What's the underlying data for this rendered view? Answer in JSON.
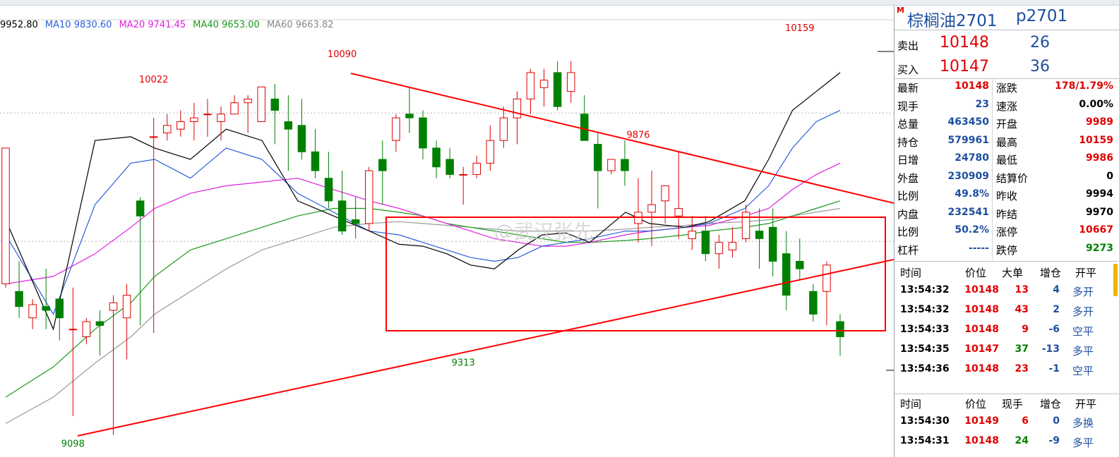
{
  "legend": {
    "close": "9952.80",
    "ma10": "MA10 9830.60",
    "ma20": "MA20 9741.45",
    "ma40": "MA40 9653.00",
    "ma60": "MA60 9663.82"
  },
  "colors": {
    "up": "#e00000",
    "down": "#008000",
    "ma5": "#000000",
    "ma10": "#2b5fd9",
    "ma20": "#e020e0",
    "ma40": "#1a9a1a",
    "ma60": "#999999",
    "pattern": "#ff0000"
  },
  "chart_data": {
    "type": "candlestick",
    "ylim": [
      9060,
      10200
    ],
    "annotations": [
      {
        "text": "10090",
        "candle": 25,
        "price": 10090,
        "pos": "above"
      },
      {
        "text": "10022",
        "candle": 11,
        "price": 10022,
        "pos": "above"
      },
      {
        "text": "9876",
        "candle": 47,
        "price": 9876,
        "pos": "above"
      },
      {
        "text": "10159",
        "candle": 59,
        "price": 10159,
        "pos": "above"
      },
      {
        "text": "9313",
        "candle": 34,
        "price": 9313,
        "pos": "below"
      },
      {
        "text": "9098",
        "candle": 5,
        "price": 9098,
        "pos": "below"
      }
    ],
    "candles": [
      [
        9500,
        9860,
        9860,
        9490
      ],
      [
        9480,
        9440,
        9560,
        9410
      ],
      [
        9410,
        9445,
        9460,
        9380
      ],
      [
        9440,
        9430,
        9540,
        9380
      ],
      [
        9460,
        9410,
        9450,
        9350
      ],
      [
        9380,
        9380,
        9490,
        9150
      ],
      [
        9360,
        9400,
        9410,
        9340
      ],
      [
        9400,
        9390,
        9430,
        9310
      ],
      [
        9430,
        9450,
        9470,
        9100
      ],
      [
        9410,
        9470,
        9500,
        9300
      ],
      [
        9720,
        9680,
        9730,
        9390
      ],
      [
        9890,
        9890,
        9940,
        9370
      ],
      [
        9900,
        9920,
        9950,
        9880
      ],
      [
        9910,
        9930,
        9960,
        9890
      ],
      [
        9930,
        9940,
        9980,
        9880
      ],
      [
        9950,
        9950,
        9990,
        9890
      ],
      [
        9930,
        9950,
        9970,
        9880
      ],
      [
        9950,
        9980,
        10000,
        9950
      ],
      [
        9980,
        9990,
        10000,
        9900
      ],
      [
        9930,
        10022,
        10022,
        9930
      ],
      [
        9990,
        9960,
        10030,
        9870
      ],
      [
        9930,
        9910,
        10000,
        9800
      ],
      [
        9920,
        9850,
        9990,
        9830
      ],
      [
        9850,
        9800,
        9910,
        9780
      ],
      [
        9780,
        9720,
        9850,
        9700
      ],
      [
        9720,
        9640,
        9800,
        9630
      ],
      [
        9670,
        9660,
        9730,
        9620
      ],
      [
        9660,
        9800,
        9810,
        9640
      ],
      [
        9830,
        9800,
        9880,
        9710
      ],
      [
        9880,
        9940,
        9950,
        9850
      ],
      [
        9950,
        9940,
        10020,
        9900
      ],
      [
        9940,
        9860,
        9960,
        9830
      ],
      [
        9860,
        9810,
        9880,
        9780
      ],
      [
        9830,
        9790,
        9860,
        9780
      ],
      [
        9790,
        9790,
        9810,
        9710
      ],
      [
        9790,
        9820,
        9840,
        9780
      ],
      [
        9820,
        9880,
        9920,
        9800
      ],
      [
        9880,
        9940,
        9970,
        9860
      ],
      [
        9940,
        9990,
        10010,
        9870
      ],
      [
        9990,
        10060,
        10070,
        9950
      ],
      [
        10020,
        10040,
        10070,
        9970
      ],
      [
        10060,
        9970,
        10090,
        9960
      ],
      [
        10010,
        10060,
        10090,
        9980
      ],
      [
        9950,
        9880,
        10000,
        9900
      ],
      [
        9870,
        9800,
        9900,
        9700
      ],
      [
        9800,
        9830,
        9830,
        9790
      ],
      [
        9830,
        9800,
        9880,
        9760
      ],
      [
        9660,
        9690,
        9780,
        9610
      ],
      [
        9690,
        9710,
        9800,
        9600
      ],
      [
        9720,
        9760,
        9750,
        9660
      ],
      [
        9680,
        9700,
        9850,
        9620
      ],
      [
        9620,
        9640,
        9680,
        9590
      ],
      [
        9640,
        9580,
        9680,
        9560
      ],
      [
        9580,
        9610,
        9630,
        9540
      ],
      [
        9590,
        9610,
        9650,
        9570
      ],
      [
        9620,
        9690,
        9710,
        9610
      ],
      [
        9640,
        9620,
        9700,
        9540
      ],
      [
        9650,
        9560,
        9700,
        9520
      ],
      [
        9580,
        9470,
        9640,
        9430
      ],
      [
        9560,
        9540,
        9620,
        9510
      ],
      [
        9480,
        9420,
        9500,
        9400
      ],
      [
        9480,
        9550,
        9560,
        9390
      ],
      [
        9400,
        9360,
        9420,
        9310
      ]
    ],
    "ma5": [
      [
        0,
        9670
      ],
      [
        8,
        9380
      ],
      [
        15,
        9880
      ],
      [
        21,
        9890
      ],
      [
        25,
        9860
      ],
      [
        31,
        9830
      ],
      [
        37,
        9910
      ],
      [
        43,
        9880
      ],
      [
        49,
        9720
      ],
      [
        55,
        9680
      ],
      [
        61,
        9640
      ],
      [
        66,
        9605
      ],
      [
        70,
        9600
      ],
      [
        74,
        9580
      ],
      [
        78,
        9550
      ],
      [
        82,
        9540
      ],
      [
        86,
        9590
      ],
      [
        90,
        9630
      ],
      [
        94,
        9635
      ],
      [
        98,
        9610
      ],
      [
        104,
        9690
      ],
      [
        108,
        9660
      ],
      [
        114,
        9650
      ],
      [
        118,
        9665
      ],
      [
        124,
        9720
      ],
      [
        128,
        9830
      ],
      [
        132,
        9960
      ],
      [
        136,
        10010
      ],
      [
        140,
        10060
      ]
    ],
    "ma10": [
      [
        0,
        9630
      ],
      [
        8,
        9420
      ],
      [
        15,
        9710
      ],
      [
        21,
        9820
      ],
      [
        25,
        9830
      ],
      [
        31,
        9780
      ],
      [
        37,
        9860
      ],
      [
        43,
        9830
      ],
      [
        49,
        9740
      ],
      [
        55,
        9690
      ],
      [
        61,
        9640
      ],
      [
        66,
        9630
      ],
      [
        70,
        9610
      ],
      [
        74,
        9590
      ],
      [
        78,
        9570
      ],
      [
        82,
        9560
      ],
      [
        86,
        9570
      ],
      [
        90,
        9600
      ],
      [
        94,
        9610
      ],
      [
        98,
        9620
      ],
      [
        104,
        9640
      ],
      [
        108,
        9640
      ],
      [
        114,
        9650
      ],
      [
        118,
        9660
      ],
      [
        124,
        9700
      ],
      [
        128,
        9760
      ],
      [
        132,
        9860
      ],
      [
        136,
        9930
      ],
      [
        140,
        9960
      ]
    ],
    "ma20": [
      [
        0,
        9500
      ],
      [
        8,
        9520
      ],
      [
        15,
        9580
      ],
      [
        21,
        9650
      ],
      [
        25,
        9700
      ],
      [
        31,
        9740
      ],
      [
        37,
        9760
      ],
      [
        43,
        9770
      ],
      [
        49,
        9780
      ],
      [
        55,
        9750
      ],
      [
        61,
        9720
      ],
      [
        66,
        9700
      ],
      [
        70,
        9680
      ],
      [
        74,
        9660
      ],
      [
        78,
        9640
      ],
      [
        82,
        9620
      ],
      [
        86,
        9610
      ],
      [
        90,
        9600
      ],
      [
        94,
        9600
      ],
      [
        98,
        9610
      ],
      [
        104,
        9630
      ],
      [
        108,
        9640
      ],
      [
        114,
        9650
      ],
      [
        118,
        9655
      ],
      [
        124,
        9680
      ],
      [
        128,
        9700
      ],
      [
        132,
        9750
      ],
      [
        136,
        9790
      ],
      [
        140,
        9820
      ]
    ],
    "ma40": [
      [
        0,
        9200
      ],
      [
        8,
        9280
      ],
      [
        15,
        9380
      ],
      [
        21,
        9450
      ],
      [
        25,
        9520
      ],
      [
        31,
        9590
      ],
      [
        37,
        9620
      ],
      [
        43,
        9650
      ],
      [
        49,
        9680
      ],
      [
        55,
        9700
      ],
      [
        61,
        9700
      ],
      [
        66,
        9690
      ],
      [
        70,
        9680
      ],
      [
        74,
        9660
      ],
      [
        78,
        9650
      ],
      [
        82,
        9640
      ],
      [
        86,
        9630
      ],
      [
        90,
        9620
      ],
      [
        94,
        9610
      ],
      [
        98,
        9610
      ],
      [
        104,
        9615
      ],
      [
        108,
        9620
      ],
      [
        114,
        9630
      ],
      [
        118,
        9640
      ],
      [
        124,
        9650
      ],
      [
        128,
        9660
      ],
      [
        132,
        9680
      ],
      [
        136,
        9700
      ],
      [
        140,
        9720
      ]
    ],
    "ma60": [
      [
        0,
        9130
      ],
      [
        8,
        9200
      ],
      [
        15,
        9290
      ],
      [
        21,
        9360
      ],
      [
        25,
        9420
      ],
      [
        31,
        9480
      ],
      [
        37,
        9540
      ],
      [
        43,
        9590
      ],
      [
        49,
        9620
      ],
      [
        55,
        9650
      ],
      [
        61,
        9660
      ],
      [
        66,
        9665
      ],
      [
        70,
        9660
      ],
      [
        74,
        9655
      ],
      [
        78,
        9650
      ],
      [
        82,
        9645
      ],
      [
        86,
        9640
      ],
      [
        90,
        9640
      ],
      [
        94,
        9640
      ],
      [
        98,
        9640
      ],
      [
        104,
        9645
      ],
      [
        108,
        9650
      ],
      [
        114,
        9655
      ],
      [
        118,
        9660
      ],
      [
        124,
        9665
      ],
      [
        128,
        9670
      ],
      [
        132,
        9680
      ],
      [
        136,
        9690
      ],
      [
        140,
        9700
      ]
    ]
  },
  "quote": {
    "title": "棕榈油2701",
    "code": "p2701",
    "m_icon": "M",
    "sell_label": "卖出",
    "sell_price": "10148",
    "sell_qty": "26",
    "buy_label": "买入",
    "buy_price": "10147",
    "buy_qty": "36",
    "stats": [
      {
        "l1": "最新",
        "v1": "10148",
        "c1": "red",
        "l2": "涨跌",
        "v2": "178/1.79%",
        "c2": "red"
      },
      {
        "l1": "现手",
        "v1": "23",
        "c1": "blue",
        "l2": "速涨",
        "v2": "0.00%",
        "c2": "black"
      },
      {
        "l1": "总量",
        "v1": "463450",
        "c1": "blue",
        "l2": "开盘",
        "v2": "9989",
        "c2": "red"
      },
      {
        "l1": "持仓",
        "v1": "579961",
        "c1": "blue",
        "l2": "最高",
        "v2": "10159",
        "c2": "red"
      },
      {
        "l1": "日增",
        "v1": "24780",
        "c1": "blue",
        "l2": "最低",
        "v2": "9986",
        "c2": "red"
      },
      {
        "l1": "外盘",
        "v1": "230909",
        "c1": "blue",
        "l2": "结算价",
        "v2": "0",
        "c2": "black"
      },
      {
        "l1": "比例",
        "v1": "49.8%",
        "c1": "blue",
        "l2": "昨收",
        "v2": "9994",
        "c2": "black"
      },
      {
        "l1": "内盘",
        "v1": "232541",
        "c1": "blue",
        "l2": "昨结",
        "v2": "9970",
        "c2": "black"
      },
      {
        "l1": "比例",
        "v1": "50.2%",
        "c1": "blue",
        "l2": "涨停",
        "v2": "10667",
        "c2": "red"
      },
      {
        "l1": "杠杆",
        "v1": "-----",
        "c1": "blue",
        "l2": "跌停",
        "v2": "9273",
        "c2": "green"
      }
    ],
    "ticks_header": [
      "时间",
      "价位",
      "大单",
      "增仓",
      "开平"
    ],
    "ticks": [
      {
        "t": "13:54:32",
        "p": "10148",
        "q": "13",
        "qc": "red",
        "z": "4",
        "k": "多开"
      },
      {
        "t": "13:54:32",
        "p": "10148",
        "q": "43",
        "qc": "red",
        "z": "2",
        "k": "多开"
      },
      {
        "t": "13:54:33",
        "p": "10148",
        "q": "9",
        "qc": "red",
        "z": "-6",
        "k": "空平"
      },
      {
        "t": "13:54:35",
        "p": "10147",
        "q": "37",
        "qc": "green",
        "z": "-13",
        "k": "多平"
      },
      {
        "t": "13:54:36",
        "p": "10148",
        "q": "23",
        "qc": "red",
        "z": "-1",
        "k": "空平"
      }
    ],
    "trades_header": [
      "时间",
      "价位",
      "现手",
      "增仓",
      "开平"
    ],
    "trades": [
      {
        "t": "13:54:30",
        "p": "10149",
        "q": "6",
        "qc": "red",
        "z": "0",
        "k": "多换"
      },
      {
        "t": "13:54:31",
        "p": "10148",
        "q": "24",
        "qc": "green",
        "z": "-9",
        "k": "多平"
      }
    ]
  }
}
